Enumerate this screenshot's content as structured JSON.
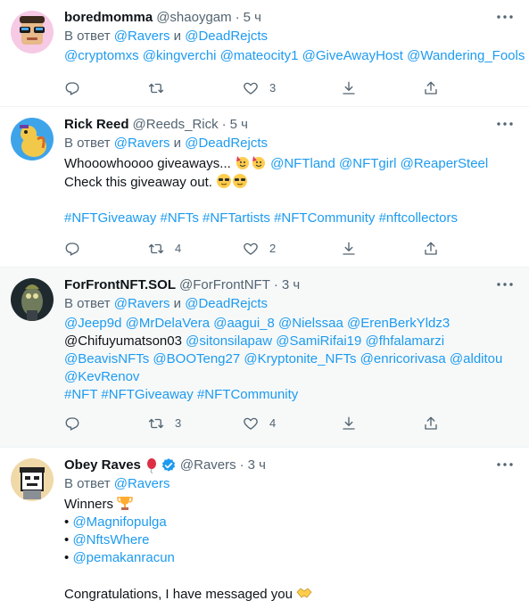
{
  "reply_prefix": "В ответ",
  "and_word": "и",
  "tweets": [
    {
      "name": "boredmomma",
      "handle": "@shaoygam",
      "time": "5 ч",
      "reply_to": [
        "@Ravers",
        "@DeadRejcts"
      ],
      "mentions_line": [
        "@cryptomxs",
        "@kingverchi",
        "@mateocity1",
        "@GiveAwayHost",
        "@Wandering_Fools"
      ],
      "reply_count": "",
      "retweet_count": "",
      "like_count": "3"
    },
    {
      "name": "Rick Reed",
      "handle": "@Reeds_Rick",
      "time": "5 ч",
      "reply_to": [
        "@Ravers",
        "@DeadRejcts"
      ],
      "text_line1": "Whooowhoooo giveaways...",
      "line1_mentions": [
        "@NFTland",
        "@NFTgirl",
        "@ReaperSteel"
      ],
      "text_line2": "Check this giveaway out.",
      "hashtags": [
        "#NFTGiveaway",
        "#NFTs",
        "#NFTartists",
        "#NFTCommunity",
        "#nftcollectors"
      ],
      "reply_count": "",
      "retweet_count": "4",
      "like_count": "2"
    },
    {
      "name": "ForFrontNFT.SOL",
      "handle": "@ForFrontNFT",
      "time": "3 ч",
      "reply_to": [
        "@Ravers",
        "@DeadRejcts"
      ],
      "mention_lines": [
        [
          "@Jeep9d",
          "@MrDelaVera",
          "@aagui_8",
          "@Nielssaa",
          "@ErenBerkYldz3"
        ],
        [
          "@Chifuyumatson03",
          "@sitonsilapaw",
          "@SamiRifai19",
          "@fhfalamarzi"
        ],
        [
          "@BeavisNFTs",
          "@BOOTeng27",
          "@Kryptonite_NFTs",
          "@enricorivasa",
          "@alditou"
        ],
        [
          "@KevRenov"
        ]
      ],
      "hashtags": [
        "#NFT",
        "#NFTGiveaway",
        "#NFTCommunity"
      ],
      "reply_count": "",
      "retweet_count": "3",
      "like_count": "4"
    },
    {
      "name": "Obey Raves",
      "handle": "@Ravers",
      "time": "3 ч",
      "reply_to": [
        "@Ravers"
      ],
      "winners_label": "Winners",
      "bullet": "•",
      "winners": [
        "@Magnifopulga",
        "@NftsWhere",
        "@pemakanracun"
      ],
      "closing": "Congratulations, I have messaged you"
    }
  ],
  "colors": {
    "link": "#1d9bf0",
    "secondary": "#536471",
    "verified": "#1d9bf0"
  },
  "icons": [
    "reply-icon",
    "retweet-icon",
    "like-icon",
    "save-icon",
    "share-icon",
    "more-icon",
    "verified-icon",
    "balloon-icon",
    "trophy-icon",
    "party-face-icon",
    "sunglasses-face-icon",
    "handshake-icon"
  ]
}
